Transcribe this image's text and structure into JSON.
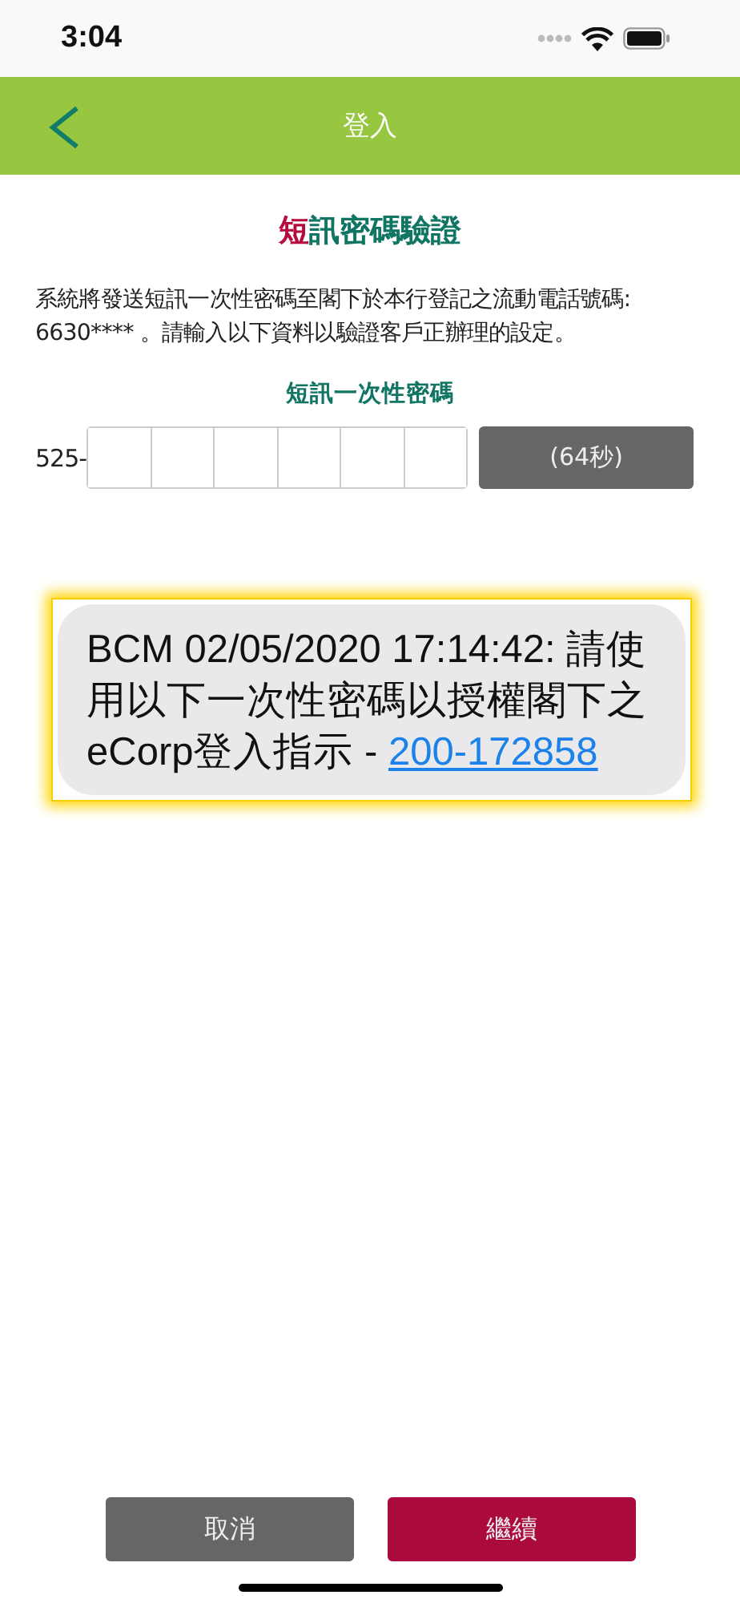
{
  "status_bar": {
    "time": "3:04"
  },
  "nav": {
    "title": "登入"
  },
  "title": {
    "accent": "短",
    "rest": "訊密碼驗證"
  },
  "description": "系統將發送短訊一次性密碼至閣下於本行登記之流動電話號碼: 6630**** 。請輸入以下資料以驗證客戶正辦理的設定。",
  "otp": {
    "label": "短訊一次性密碼",
    "prefix": "525-",
    "cells": [
      {
        "filled": false
      },
      {
        "filled": false
      },
      {
        "filled": false
      },
      {
        "filled": false
      },
      {
        "filled": false
      },
      {
        "filled": false
      }
    ],
    "resend": {
      "label": "(64秒)",
      "disabled": true
    }
  },
  "sms": {
    "text": "BCM 02/05/2020 17:14:42: 請使用以下一次性密碼以授權閣下之 eCorp登入指示 - ",
    "link": "200-172858",
    "highlighted": true
  },
  "buttons": [
    {
      "label": "取消",
      "kind": "secondary"
    },
    {
      "label": "繼續",
      "kind": "primary"
    }
  ]
}
